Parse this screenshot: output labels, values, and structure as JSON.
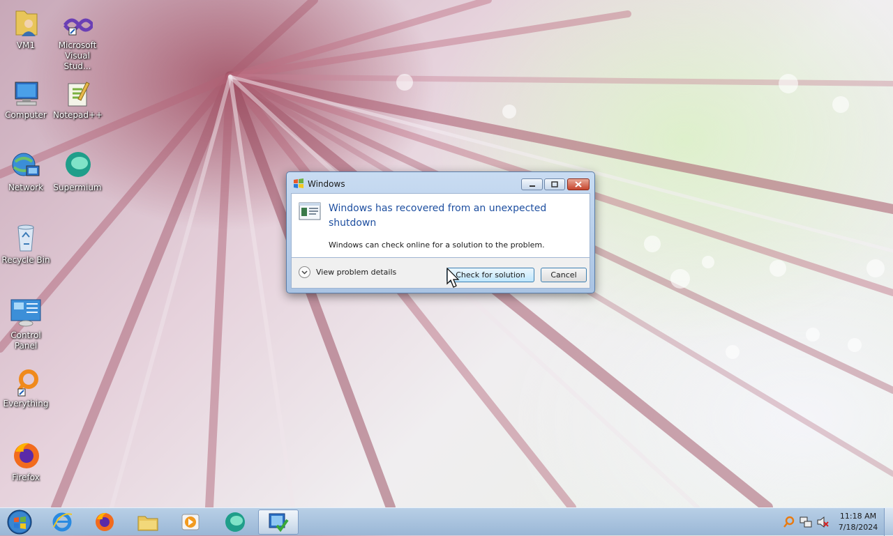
{
  "desktop_icons": [
    {
      "label": "VM1",
      "icon": "user-folder-icon"
    },
    {
      "label": "Microsoft Visual Stud...",
      "icon": "visual-studio-icon"
    },
    {
      "label": "Computer",
      "icon": "computer-icon"
    },
    {
      "label": "Notepad++",
      "icon": "notepad-plus-plus-icon"
    },
    {
      "label": "Network",
      "icon": "network-icon"
    },
    {
      "label": "Supermium",
      "icon": "supermium-icon"
    },
    {
      "label": "Recycle Bin",
      "icon": "recycle-bin-icon"
    },
    {
      "label": "Control Panel",
      "icon": "control-panel-icon"
    },
    {
      "label": "Everything",
      "icon": "everything-search-icon"
    },
    {
      "label": "Firefox",
      "icon": "firefox-icon"
    }
  ],
  "dialog": {
    "title": "Windows",
    "heading": "Windows has recovered from an unexpected shutdown",
    "message": "Windows can check online for a solution to the problem.",
    "details_label": "View problem details",
    "primary_button": "Check for solution",
    "cancel_button": "Cancel"
  },
  "taskbar": {
    "pinned": [
      "start-orb-icon",
      "internet-explorer-icon",
      "firefox-icon",
      "file-explorer-icon",
      "media-player-icon",
      "supermium-icon",
      "error-reporting-icon"
    ],
    "clock": {
      "time": "11:18 AM",
      "date": "7/18/2024"
    },
    "tray": [
      "everything-search-icon",
      "network-status-icon",
      "volume-muted-icon"
    ]
  },
  "colors": {
    "heading": "#1e4fa0",
    "taskbar": "#a9c3e0",
    "close_button": "#c6452e"
  }
}
